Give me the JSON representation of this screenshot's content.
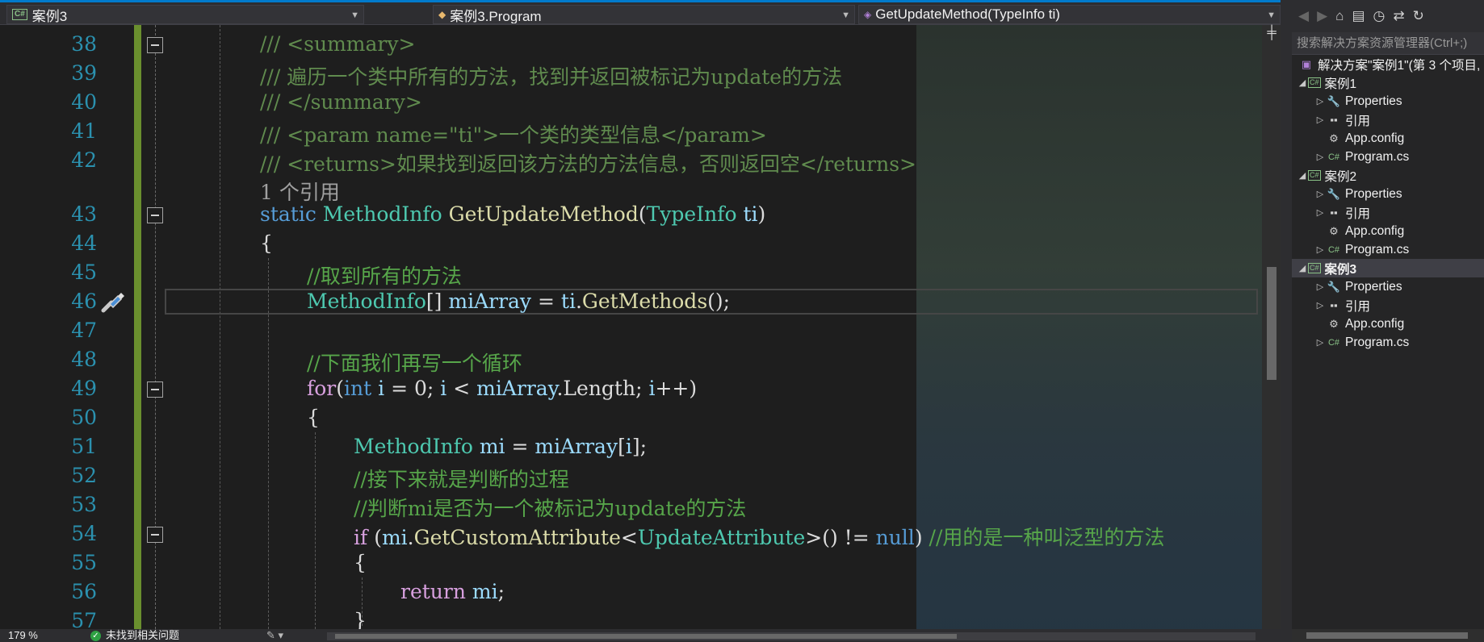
{
  "navbar": {
    "project": "案例3",
    "class": "案例3.Program",
    "member": "GetUpdateMethod(TypeInfo ti)"
  },
  "editor": {
    "line_numbers": [
      "38",
      "39",
      "40",
      "41",
      "42",
      "43",
      "44",
      "45",
      "46",
      "47",
      "48",
      "49",
      "50",
      "51",
      "52",
      "53",
      "54",
      "55",
      "56",
      "57"
    ],
    "lines": {
      "l38": "/// <summary>",
      "l39": "/// 遍历一个类中所有的方法，找到并返回被标记为update的方法",
      "l40": "/// </summary>",
      "l41": "/// <param name=\"ti\">一个类的类型信息</param>",
      "l42": "/// <returns>如果找到返回该方法的方法信息，否则返回空</returns>",
      "codelens": "1 个引用",
      "l43_kw": "static",
      "l43_type": "MethodInfo",
      "l43_method": "GetUpdateMethod",
      "l43_paren_open": "(",
      "l43_ptype": "TypeInfo",
      "l43_param": "ti",
      "l43_paren_close": ")",
      "l44": "{",
      "l45": "//取到所有的方法",
      "l46_type": "MethodInfo",
      "l46_brackets": "[]",
      "l46_var": "miArray",
      "l46_eq": "=",
      "l46_obj": "ti",
      "l46_dot": ".",
      "l46_method": "GetMethods",
      "l46_end": "();",
      "l48": "//下面我们再写一个循环",
      "l49_for": "for",
      "l49_open": "(",
      "l49_int": "int",
      "l49_i": "i",
      "l49_rest1": " = 0; ",
      "l49_i2": "i",
      "l49_lt": " < ",
      "l49_arr": "miArray",
      "l49_len": ".Length; ",
      "l49_i3": "i",
      "l49_inc": "++)",
      "l50": "{",
      "l51_type": "MethodInfo",
      "l51_var": "mi",
      "l51_eq": " = ",
      "l51_arr": "miArray",
      "l51_idx_open": "[",
      "l51_i": "i",
      "l51_idx_close": "];",
      "l52": "//接下来就是判断的过程",
      "l53": "//判断mi是否为一个被标记为update的方法",
      "l54_if": "if",
      "l54_open": " (",
      "l54_mi": "mi",
      "l54_dot": ".",
      "l54_method": "GetCustomAttribute",
      "l54_lt": "<",
      "l54_attr": "UpdateAttribute",
      "l54_gt": ">() != ",
      "l54_null": "null",
      "l54_close": ") ",
      "l54_comment": "//用的是一种叫泛型的方法",
      "l55": "{",
      "l56_return": "return",
      "l56_mi": "mi",
      "l56_semi": ";",
      "l57": "}"
    }
  },
  "status": {
    "zoom": "179 %",
    "issues": "未找到相关问题"
  },
  "explorer": {
    "search_placeholder": "搜索解决方案资源管理器(Ctrl+;)",
    "solution": "解决方案\"案例1\"(第 3 个项目,",
    "projects": [
      {
        "name": "案例1",
        "items": [
          "Properties",
          "引用",
          "App.config",
          "Program.cs"
        ]
      },
      {
        "name": "案例2",
        "items": [
          "Properties",
          "引用",
          "App.config",
          "Program.cs"
        ]
      },
      {
        "name": "案例3",
        "items": [
          "Properties",
          "引用",
          "App.config",
          "Program.cs"
        ]
      }
    ]
  },
  "colors": {
    "accent": "#007acc",
    "comment": "#57a64a",
    "keyword": "#569cd6",
    "type": "#4ec9b0",
    "method": "#dcdcaa",
    "change_bar": "#6a8f2e"
  }
}
